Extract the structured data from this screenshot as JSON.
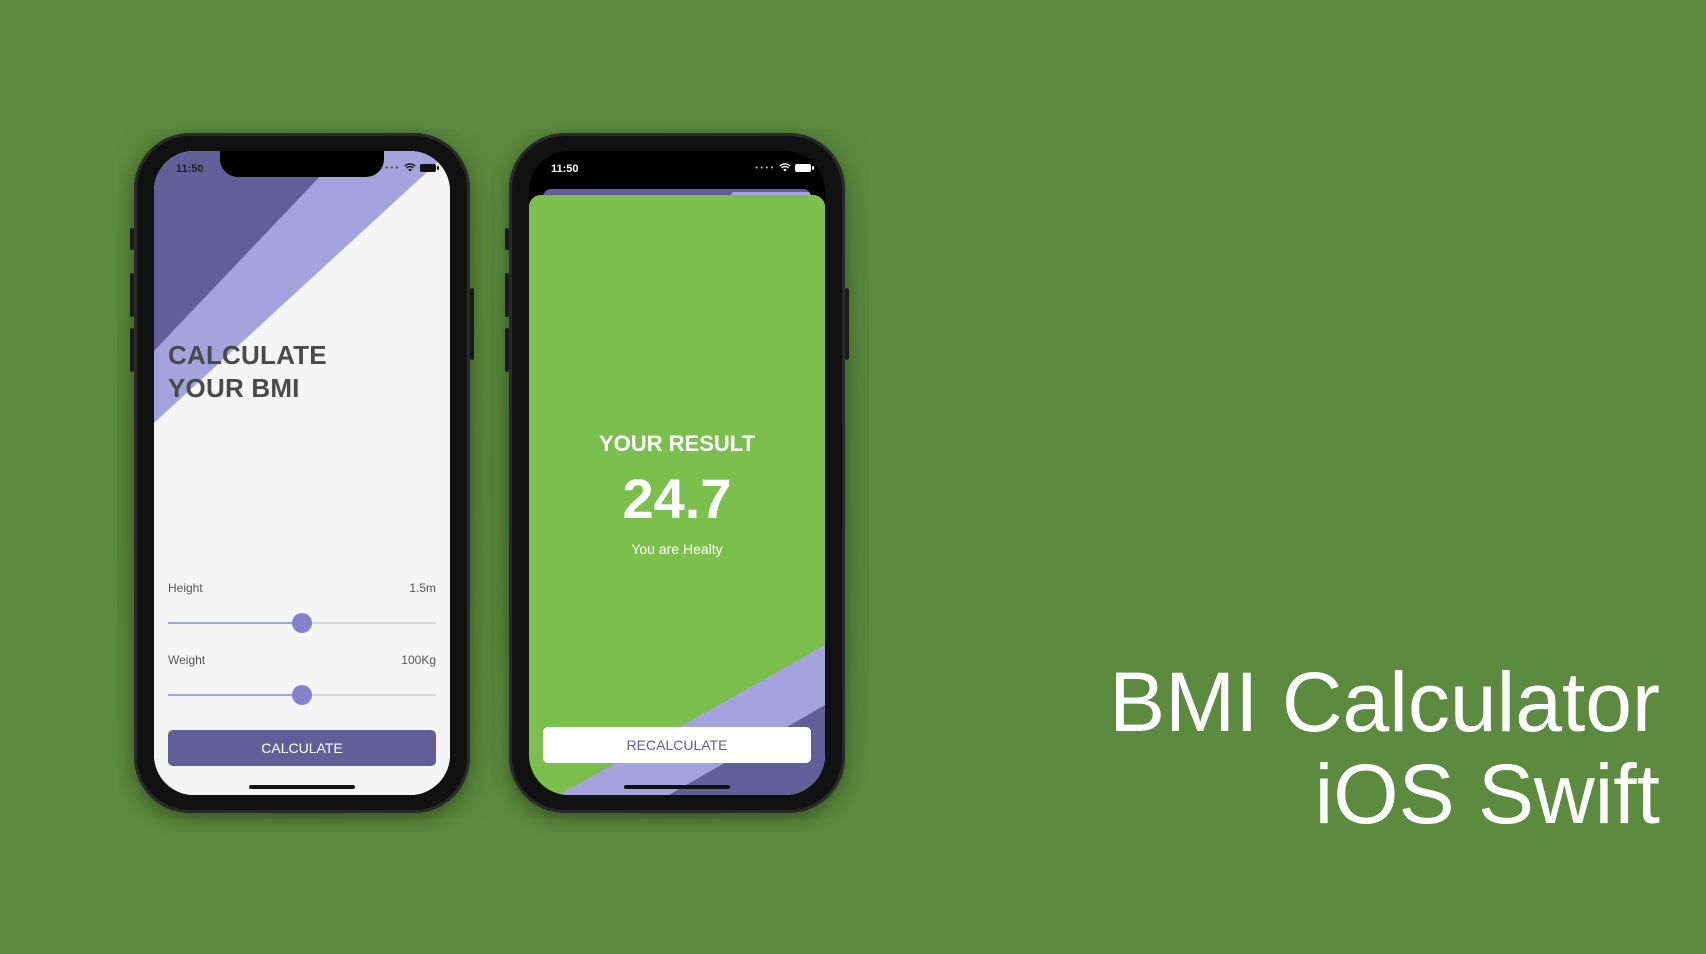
{
  "colors": {
    "background": "#5c8a3e",
    "purple_dark": "#625f98",
    "purple_light": "#a5a3dd",
    "green": "#7bc04d",
    "slider_thumb": "#8683cc"
  },
  "phone1": {
    "status_time": "11:50",
    "icons": [
      "signal-dots-icon",
      "wifi-icon",
      "battery-icon"
    ],
    "title_line1": "CALCULATE",
    "title_line2": "YOUR BMI",
    "height_label": "Height",
    "height_value": "1.5m",
    "height_slider_fraction": 0.5,
    "weight_label": "Weight",
    "weight_value": "100Kg",
    "weight_slider_fraction": 0.5,
    "calculate_label": "CALCULATE"
  },
  "phone2": {
    "status_time": "11:50",
    "icons": [
      "signal-dots-icon",
      "wifi-icon",
      "battery-icon"
    ],
    "result_title": "YOUR RESULT",
    "result_value": "24.7",
    "advice": "You are Healty",
    "recalculate_label": "RECALCULATE"
  },
  "caption": {
    "line1": "BMI Calculator",
    "line2": "iOS Swift"
  }
}
